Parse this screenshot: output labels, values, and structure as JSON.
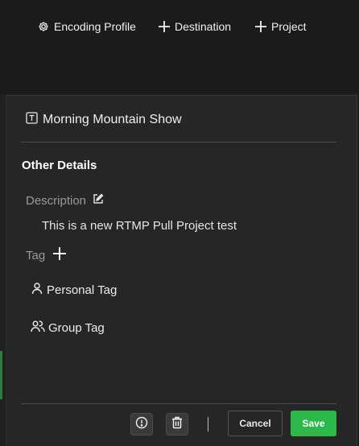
{
  "toolbar": {
    "encoding_profile": "Encoding Profile",
    "destination": "Destination",
    "project": "Project"
  },
  "project": {
    "name": "Morning Mountain Show"
  },
  "details": {
    "section_title": "Other Details",
    "description_label": "Description",
    "description_value": "This is a new RTMP Pull Project test",
    "tag_label": "Tag",
    "tags": [
      {
        "label": "Personal Tag",
        "icon": "user-icon"
      },
      {
        "label": "Group Tag",
        "icon": "users-icon"
      }
    ]
  },
  "footer": {
    "cancel_label": "Cancel",
    "save_label": "Save",
    "save_color": "#2db84b"
  }
}
